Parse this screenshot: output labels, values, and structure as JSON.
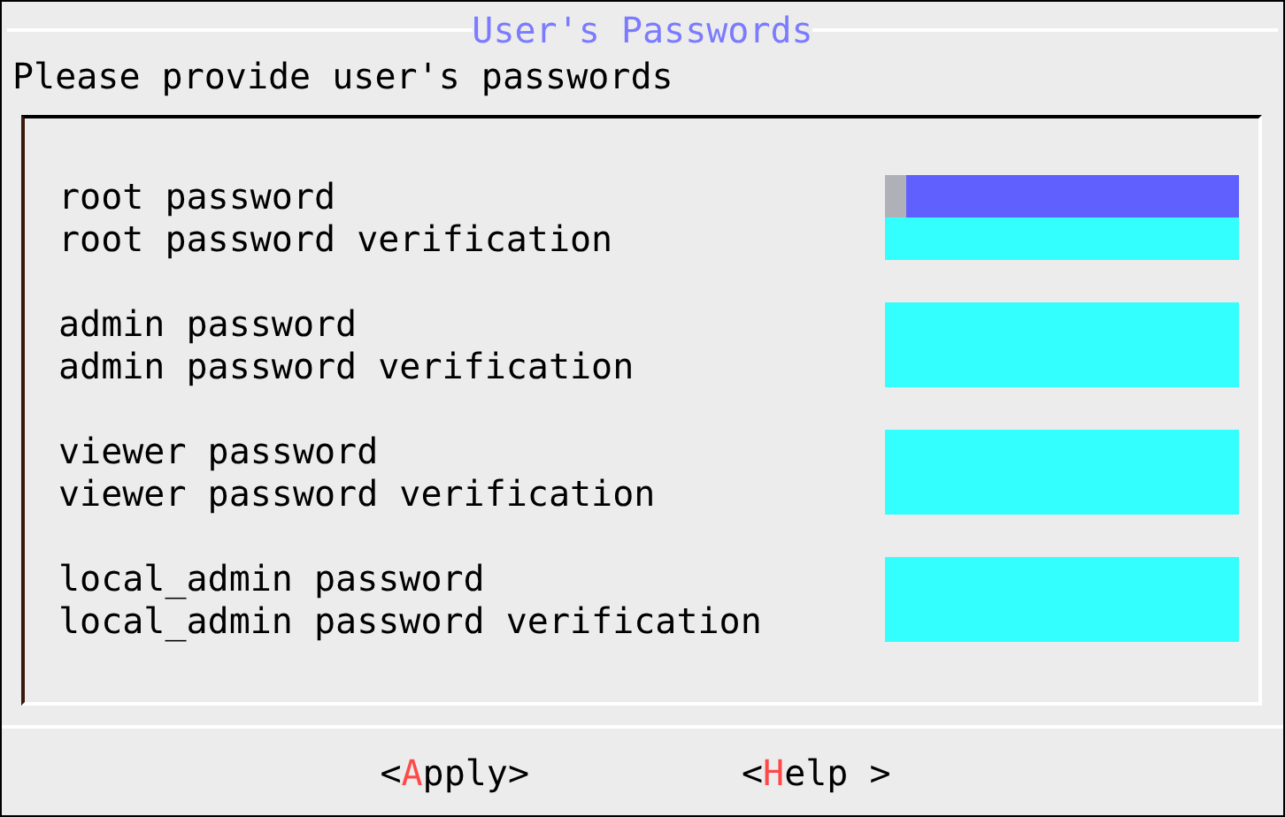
{
  "dialog": {
    "title": "User's Passwords",
    "prompt": "Please provide user's passwords"
  },
  "groups": [
    {
      "fields": [
        {
          "label": "root password",
          "selected": true
        },
        {
          "label": "root password verification",
          "selected": false
        }
      ]
    },
    {
      "fields": [
        {
          "label": "admin password",
          "selected": false
        },
        {
          "label": "admin password verification",
          "selected": false
        }
      ]
    },
    {
      "fields": [
        {
          "label": "viewer password",
          "selected": false
        },
        {
          "label": "viewer password verification",
          "selected": false
        }
      ]
    },
    {
      "fields": [
        {
          "label": "local_admin password",
          "selected": false
        },
        {
          "label": "local_admin password verification",
          "selected": false
        }
      ]
    }
  ],
  "buttons": [
    {
      "open": "<",
      "hotkey": "A",
      "rest": "pply>"
    },
    {
      "open": "<",
      "hotkey": "H",
      "rest": "elp >"
    }
  ]
}
